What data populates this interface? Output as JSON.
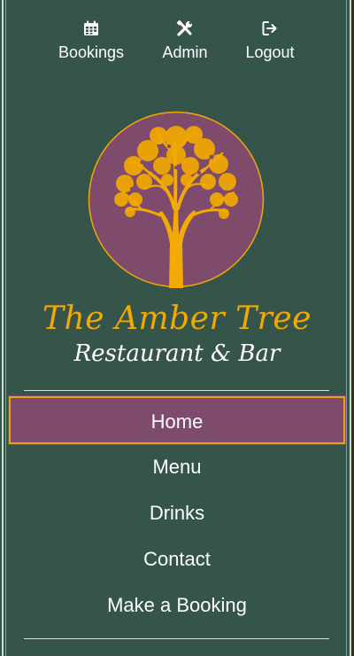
{
  "top_nav": [
    {
      "label": "Bookings",
      "icon": "calendar-icon"
    },
    {
      "label": "Admin",
      "icon": "tools-icon"
    },
    {
      "label": "Logout",
      "icon": "sign-out-icon"
    }
  ],
  "brand": {
    "title": "The Amber Tree",
    "subtitle": "Restaurant & Bar",
    "logo_icon": "tree-icon",
    "colors": {
      "amber": "#f2a900",
      "purple": "#7f4b6d",
      "green": "#35544a"
    }
  },
  "menu": {
    "items": [
      {
        "label": "Home",
        "active": true
      },
      {
        "label": "Menu",
        "active": false
      },
      {
        "label": "Drinks",
        "active": false
      },
      {
        "label": "Contact",
        "active": false
      },
      {
        "label": "Make a Booking",
        "active": false
      }
    ]
  }
}
